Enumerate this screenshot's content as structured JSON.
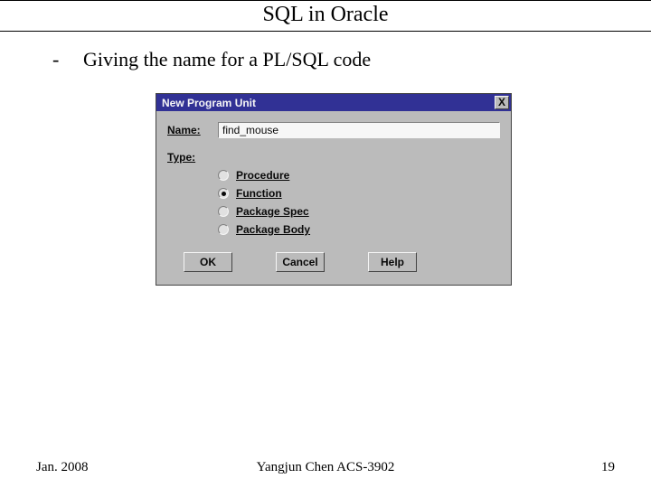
{
  "slide": {
    "title": "SQL in Oracle",
    "bullet_dash": "-",
    "bullet_text": "Giving the name for a PL/SQL code"
  },
  "dialog": {
    "title": "New Program Unit",
    "close_glyph": "X",
    "name_label": "Name:",
    "name_value": "find_mouse",
    "type_label": "Type:",
    "types": [
      {
        "label": "Procedure",
        "selected": false
      },
      {
        "label": "Function",
        "selected": true
      },
      {
        "label": "Package Spec",
        "selected": false
      },
      {
        "label": "Package Body",
        "selected": false
      }
    ],
    "buttons": {
      "ok": "OK",
      "cancel": "Cancel",
      "help": "Help"
    }
  },
  "footer": {
    "left": "Jan. 2008",
    "center": "Yangjun Chen      ACS-3902",
    "right": "19"
  }
}
